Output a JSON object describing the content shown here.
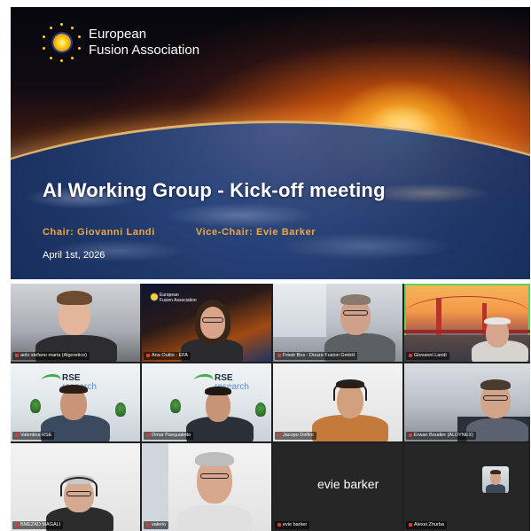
{
  "slide": {
    "logo_line1": "European",
    "logo_line2": "Fusion Association",
    "title": "AI Working Group - Kick-off meeting",
    "chair": "Chair: Giovanni Landi",
    "vice_chair": "Vice-Chair: Evie Barker",
    "date": "April 1st, 2026"
  },
  "participants": [
    {
      "name": "aolo stefano maria (Algoretico)"
    },
    {
      "name": "Ana Outilo - EFA"
    },
    {
      "name": "Freek Bos - Douze Fusion GmbH"
    },
    {
      "name": "Giovanni Landi"
    },
    {
      "name": "Valentina RSE"
    },
    {
      "name": "Omar Pasqualetto"
    },
    {
      "name": "Jacopo Delfini"
    },
    {
      "name": "Erwan Boudier (ALDYNEX)"
    },
    {
      "name": "BMEZAD MAGALI"
    },
    {
      "name": "valerio"
    },
    {
      "name": "evie barker",
      "large_label": "evie barker"
    },
    {
      "name": "Alexei Zhurba"
    }
  ],
  "tile_overlays": {
    "efa_logo_line1": "European",
    "efa_logo_line2": "Fusion Association",
    "rse_brand_1": "RSE",
    "rse_brand_2": "research"
  },
  "colors": {
    "accent_orange": "#f2a63c",
    "speaking_border": "#5dd35d",
    "grid_background": "#1f1f1f"
  }
}
